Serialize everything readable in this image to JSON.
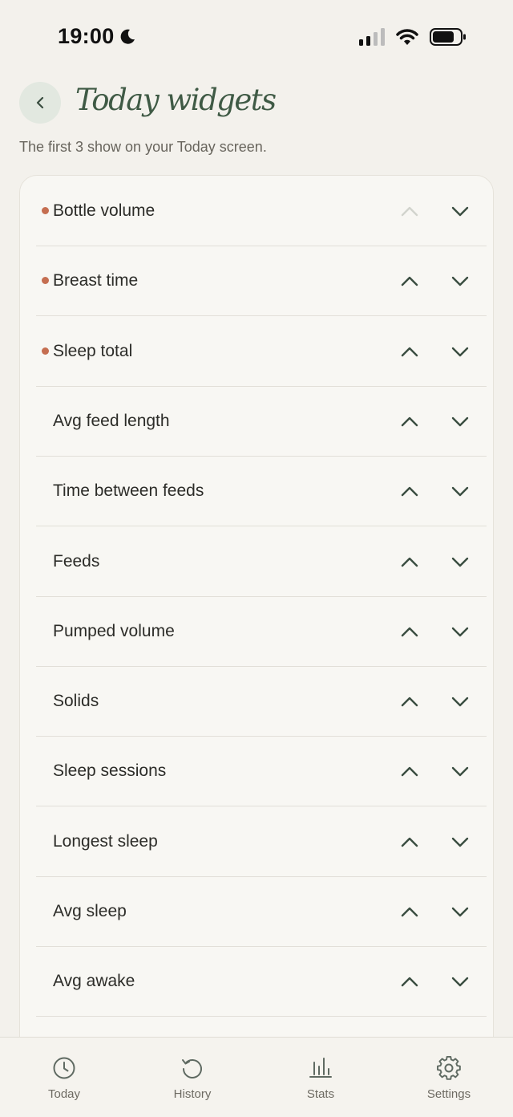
{
  "status_bar": {
    "time": "19:00"
  },
  "header": {
    "title": "Today widgets",
    "subtitle": "The first 3 show on your Today screen."
  },
  "widgets": [
    {
      "label": "Bottle volume",
      "featured": true,
      "up_enabled": false
    },
    {
      "label": "Breast time",
      "featured": true,
      "up_enabled": true
    },
    {
      "label": "Sleep total",
      "featured": true,
      "up_enabled": true
    },
    {
      "label": "Avg feed length",
      "featured": false,
      "up_enabled": true
    },
    {
      "label": "Time between feeds",
      "featured": false,
      "up_enabled": true
    },
    {
      "label": "Feeds",
      "featured": false,
      "up_enabled": true
    },
    {
      "label": "Pumped volume",
      "featured": false,
      "up_enabled": true
    },
    {
      "label": "Solids",
      "featured": false,
      "up_enabled": true
    },
    {
      "label": "Sleep sessions",
      "featured": false,
      "up_enabled": true
    },
    {
      "label": "Longest sleep",
      "featured": false,
      "up_enabled": true
    },
    {
      "label": "Avg sleep",
      "featured": false,
      "up_enabled": true
    },
    {
      "label": "Avg awake",
      "featured": false,
      "up_enabled": true
    }
  ],
  "tabbar": {
    "tabs": [
      {
        "label": "Today",
        "icon": "clock-icon"
      },
      {
        "label": "History",
        "icon": "history-icon"
      },
      {
        "label": "Stats",
        "icon": "bar-chart-icon"
      },
      {
        "label": "Settings",
        "icon": "gear-icon"
      }
    ]
  },
  "colors": {
    "background": "#f3f1ec",
    "card": "#f8f7f3",
    "accent_green": "#3f5a45",
    "featured_dot": "#c56e50",
    "disabled_arrow": "#d2d4cd"
  }
}
